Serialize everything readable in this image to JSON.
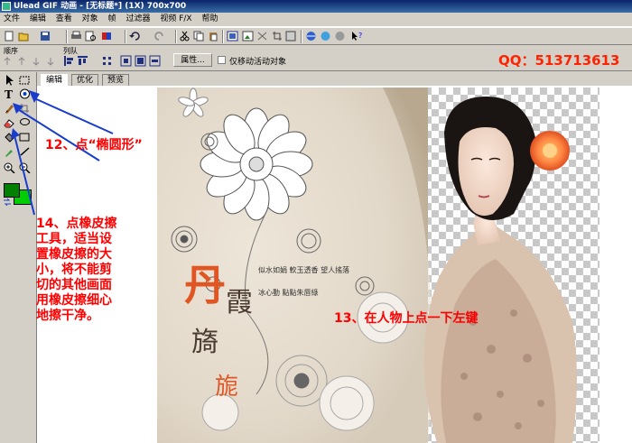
{
  "window": {
    "title": "Ulead GIF 动画 - [无标题*] (1X) 700x700"
  },
  "menu": [
    "文件",
    "编辑",
    "查看",
    "对象",
    "帧",
    "过滤器",
    "视频 F/X",
    "帮助"
  ],
  "arrange": {
    "order_label": "顺序",
    "arrange_label": "列队",
    "properties_button": "属性...",
    "checkbox_label": "仅移动活动对象"
  },
  "qq": "QQ：513713613",
  "tabs": [
    "编辑",
    "优化",
    "预览"
  ],
  "annotations": {
    "ellipse": "12、点“椭圆形”",
    "eraser": [
      "14、点橡皮擦",
      "工具，适当设",
      "置橡皮擦的大",
      "小，将不能剪",
      "切的其他画面",
      "用橡皮擦细心",
      "地擦干净。"
    ],
    "click_person": "13、在人物上点一下左键"
  },
  "artwork": {
    "title_chars": [
      "丹",
      "霞",
      "旖",
      "旎"
    ],
    "poem_lines": [
      "似水如娟  軟玉透香  望人搖落",
      "冰心動  點點朱唇綠"
    ]
  },
  "colors": {
    "foreground": "#008000",
    "background": "#00cc00",
    "annotation": "#ff0000",
    "arrow": "#1a3ccc"
  }
}
